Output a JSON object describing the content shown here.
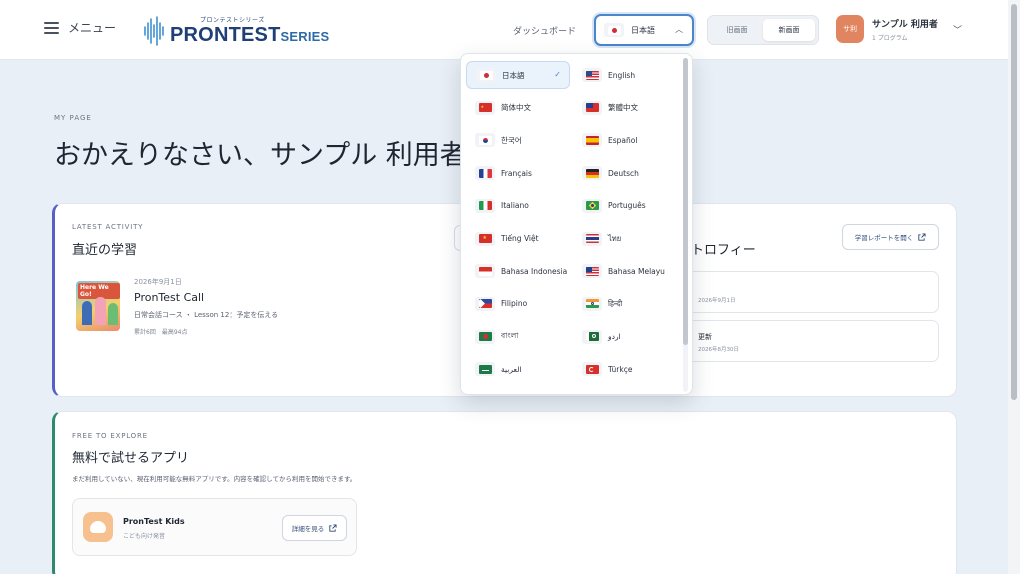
{
  "header": {
    "menu_label": "メニュー",
    "logo_small": "プロンテストシリーズ",
    "logo_main": "PRONTEST",
    "logo_series": "SERIES",
    "dashboard_link": "ダッシュボード",
    "language_button": {
      "label": "日本語",
      "flag": "jp"
    },
    "view_toggle": {
      "old": "旧画面",
      "new": "新画面",
      "active": "new"
    },
    "user": {
      "avatar_text": "サ利",
      "name": "サンプル 利用者",
      "sub": "1 プログラム"
    }
  },
  "hero": {
    "eyebrow": "MY PAGE",
    "title": "おかえりなさい、サンプル 利用者"
  },
  "activity_card": {
    "eyebrow": "LATEST ACTIVITY",
    "title": "直近の学習",
    "thumbnail_text": "Here We Go!",
    "date": "2026年9月1日",
    "app_name": "PronTest Call",
    "course": "日常会話コース ・ Lesson 12：予定を伝える",
    "meta": "累計6回　最高94点"
  },
  "trophy_card": {
    "title": "トロフィー",
    "report_button": "学習レポートを開く",
    "rows": [
      {
        "title": "",
        "date": "2026年9月1日"
      },
      {
        "title": "更新",
        "date": "2026年8月30日"
      }
    ]
  },
  "free_card": {
    "eyebrow": "FREE TO EXPLORE",
    "title": "無料で試せるアプリ",
    "description": "まだ利用していない、現在利用可能な無料アプリです。内容を確認してから利用を開始できます。",
    "app": {
      "name": "PronTest Kids",
      "sub": "こども向け発音",
      "button": "詳細を見る"
    }
  },
  "language_menu": {
    "selected": "日本語",
    "items": [
      {
        "label": "日本語",
        "flag": "jp"
      },
      {
        "label": "English",
        "flag": "us"
      },
      {
        "label": "简体中文",
        "flag": "cn"
      },
      {
        "label": "繁體中文",
        "flag": "tw"
      },
      {
        "label": "한국어",
        "flag": "kr"
      },
      {
        "label": "Español",
        "flag": "es"
      },
      {
        "label": "Français",
        "flag": "fr"
      },
      {
        "label": "Deutsch",
        "flag": "de"
      },
      {
        "label": "Italiano",
        "flag": "it"
      },
      {
        "label": "Português",
        "flag": "br"
      },
      {
        "label": "Tiếng Việt",
        "flag": "vn"
      },
      {
        "label": "ไทย",
        "flag": "th"
      },
      {
        "label": "Bahasa Indonesia",
        "flag": "id"
      },
      {
        "label": "Bahasa Melayu",
        "flag": "my"
      },
      {
        "label": "Filipino",
        "flag": "ph"
      },
      {
        "label": "हिन्दी",
        "flag": "in"
      },
      {
        "label": "বাংলা",
        "flag": "bd"
      },
      {
        "label": "اردو",
        "flag": "pk"
      },
      {
        "label": "العربية",
        "flag": "sa"
      },
      {
        "label": "Türkçe",
        "flag": "tr"
      }
    ]
  },
  "colors": {
    "accent": "#4b86c9",
    "activity_border": "#5660c8",
    "free_border": "#2e8a6c",
    "avatar": "#e0855f"
  }
}
